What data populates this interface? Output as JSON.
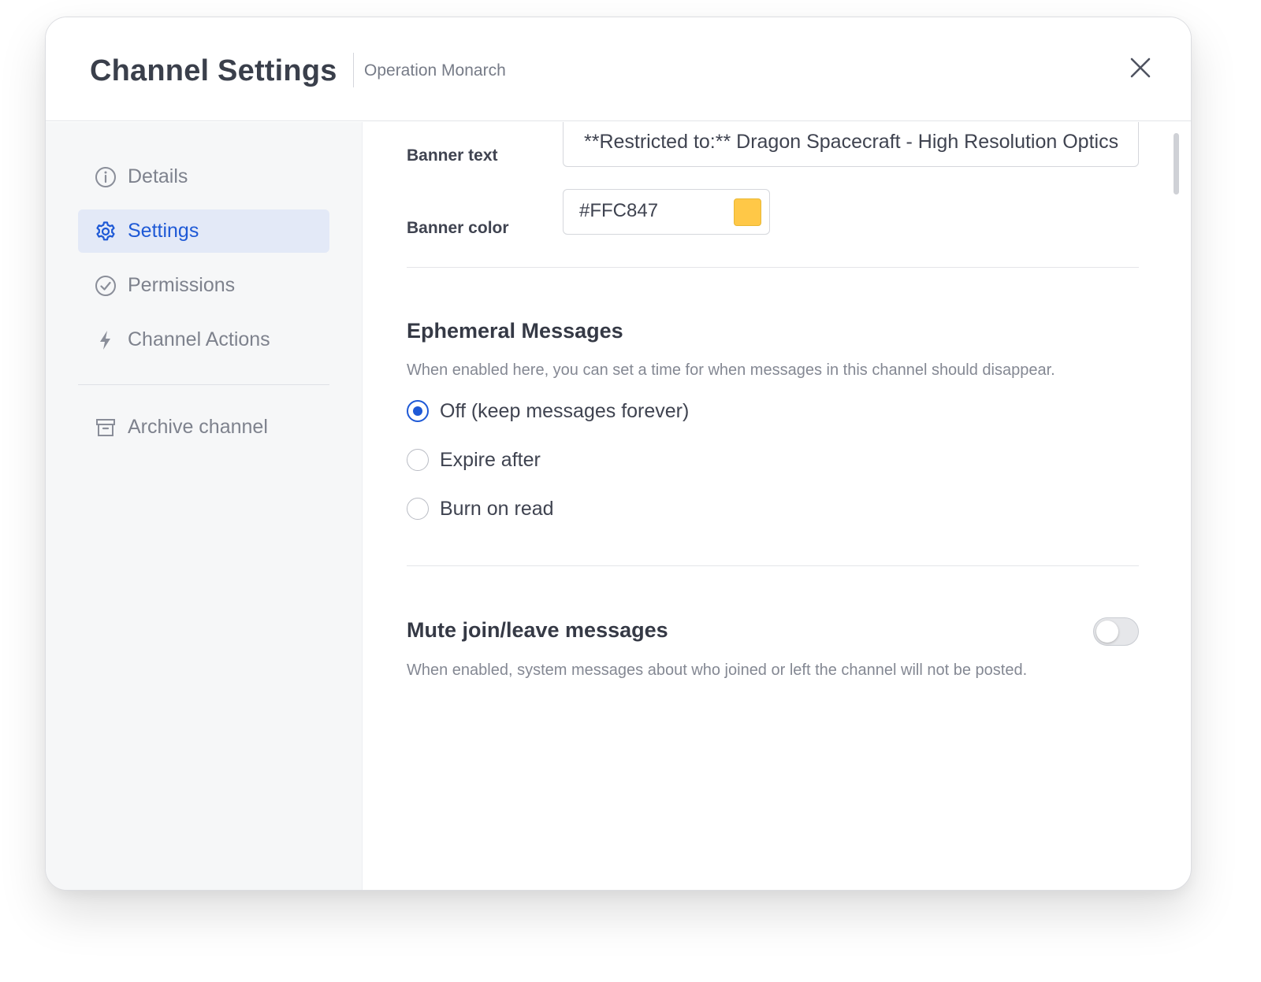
{
  "header": {
    "title": "Channel Settings",
    "channel_name": "Operation Monarch",
    "close_icon": "close-icon"
  },
  "sidebar": {
    "items": [
      {
        "label": "Details",
        "icon": "info-icon",
        "active": false
      },
      {
        "label": "Settings",
        "icon": "gear-icon",
        "active": true
      },
      {
        "label": "Permissions",
        "icon": "check-circle-icon",
        "active": false
      },
      {
        "label": "Channel Actions",
        "icon": "lightning-icon",
        "active": false
      }
    ],
    "archive": {
      "label": "Archive channel",
      "icon": "archive-icon"
    }
  },
  "banner": {
    "text_label": "Banner text",
    "text_value": "**Restricted to:** Dragon Spacecraft - High Resolution Optics",
    "color_label": "Banner color",
    "color_value": "#FFC847"
  },
  "ephemeral": {
    "title": "Ephemeral Messages",
    "description": "When enabled here, you can set a time for when messages in this channel should disappear.",
    "options": [
      {
        "label": "Off (keep messages forever)",
        "selected": true
      },
      {
        "label": "Expire after",
        "selected": false
      },
      {
        "label": "Burn on read",
        "selected": false
      }
    ]
  },
  "mute": {
    "title": "Mute join/leave messages",
    "description": "When enabled, system messages about who joined or left the channel will not be posted.",
    "enabled": false
  },
  "colors": {
    "accent": "#1e59d6",
    "active_nav_bg": "#e3e9f7",
    "banner_swatch": "#FFC847"
  }
}
